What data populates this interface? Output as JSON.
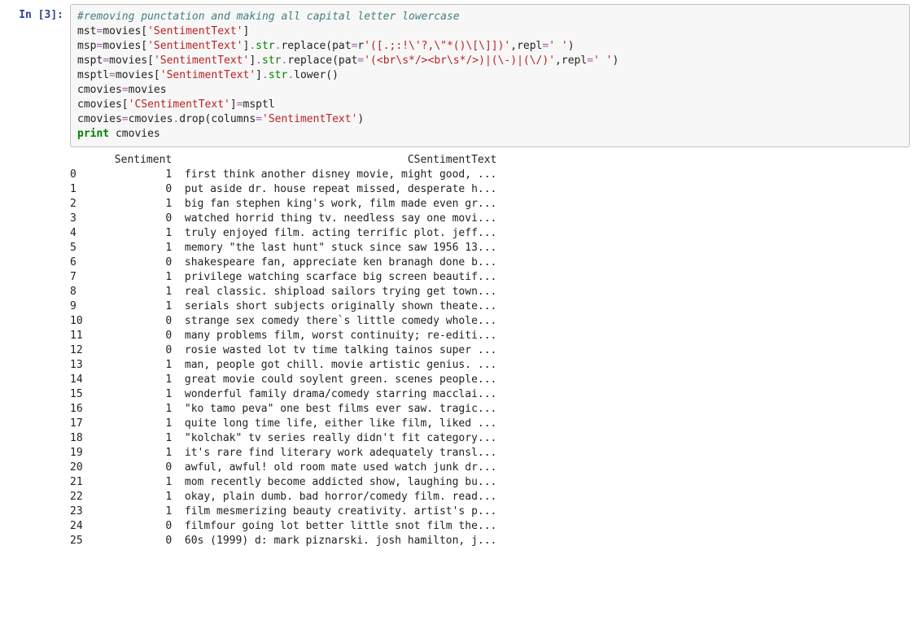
{
  "prompt": "In [3]:",
  "code": {
    "line1_comment": "#removing punctation and making all capital letter lowercase",
    "l2a": "mst",
    "l2b": "=",
    "l2c": "movies[",
    "l2d": "'SentimentText'",
    "l2e": "]",
    "l3a": "msp",
    "l3b": "=",
    "l3c": "movies[",
    "l3d": "'SentimentText'",
    "l3e": "]",
    "l3f": ".",
    "l3g": "str",
    "l3h": ".",
    "l3i": "replace(pat",
    "l3j": "=",
    "l3k": "r",
    "l3l": "'([.;:!\\'?,\\\"*()\\[\\]])'",
    "l3m": ",repl",
    "l3n": "=",
    "l3o": "' '",
    "l3p": ")",
    "l4a": "mspt",
    "l4b": "=",
    "l4c": "movies[",
    "l4d": "'SentimentText'",
    "l4e": "]",
    "l4f": ".",
    "l4g": "str",
    "l4h": ".",
    "l4i": "replace(pat",
    "l4j": "=",
    "l4l": "'(<br\\s*/><br\\s*/>)|(\\-)|(\\/)'",
    "l4m": ",repl",
    "l4n": "=",
    "l4o": "' '",
    "l4p": ")",
    "l5a": "msptl",
    "l5b": "=",
    "l5c": "movies[",
    "l5d": "'SentimentText'",
    "l5e": "]",
    "l5f": ".",
    "l5g": "str",
    "l5h": ".",
    "l5i": "lower()",
    "l6a": "cmovies",
    "l6b": "=",
    "l6c": "movies",
    "l7a": "cmovies[",
    "l7b": "'CSentimentText'",
    "l7c": "]",
    "l7d": "=",
    "l7e": "msptl",
    "l8a": "cmovies",
    "l8b": "=",
    "l8c": "cmovies",
    "l8d": ".",
    "l8e": "drop(columns",
    "l8f": "=",
    "l8g": "'SentimentText'",
    "l8h": ")",
    "l9a": "print",
    "l9b": " cmovies"
  },
  "output_header": "       Sentiment                                     CSentimentText",
  "rows": [
    {
      "i": "0",
      "s": "1",
      "t": "first think another disney movie, might good, ..."
    },
    {
      "i": "1",
      "s": "0",
      "t": "put aside dr. house repeat missed, desperate h..."
    },
    {
      "i": "2",
      "s": "1",
      "t": "big fan stephen king's work, film made even gr..."
    },
    {
      "i": "3",
      "s": "0",
      "t": "watched horrid thing tv. needless say one movi..."
    },
    {
      "i": "4",
      "s": "1",
      "t": "truly enjoyed film. acting terrific plot. jeff..."
    },
    {
      "i": "5",
      "s": "1",
      "t": "memory \"the last hunt\" stuck since saw 1956 13..."
    },
    {
      "i": "6",
      "s": "0",
      "t": "shakespeare fan, appreciate ken branagh done b..."
    },
    {
      "i": "7",
      "s": "1",
      "t": "privilege watching scarface big screen beautif..."
    },
    {
      "i": "8",
      "s": "1",
      "t": "real classic. shipload sailors trying get town..."
    },
    {
      "i": "9",
      "s": "1",
      "t": "serials short subjects originally shown theate..."
    },
    {
      "i": "10",
      "s": "0",
      "t": "strange sex comedy there`s little comedy whole..."
    },
    {
      "i": "11",
      "s": "0",
      "t": "many problems film, worst continuity; re-editi..."
    },
    {
      "i": "12",
      "s": "0",
      "t": "rosie wasted lot tv time talking tainos super ..."
    },
    {
      "i": "13",
      "s": "1",
      "t": "man, people got chill. movie artistic genius. ..."
    },
    {
      "i": "14",
      "s": "1",
      "t": "great movie could soylent green. scenes people..."
    },
    {
      "i": "15",
      "s": "1",
      "t": "wonderful family drama/comedy starring macclai..."
    },
    {
      "i": "16",
      "s": "1",
      "t": "\"ko tamo peva\" one best films ever saw. tragic..."
    },
    {
      "i": "17",
      "s": "1",
      "t": "quite long time life, either like film, liked ..."
    },
    {
      "i": "18",
      "s": "1",
      "t": "\"kolchak\" tv series really didn't fit category..."
    },
    {
      "i": "19",
      "s": "1",
      "t": "it's rare find literary work adequately transl..."
    },
    {
      "i": "20",
      "s": "0",
      "t": "awful, awful! old room mate used watch junk dr..."
    },
    {
      "i": "21",
      "s": "1",
      "t": "mom recently become addicted show, laughing bu..."
    },
    {
      "i": "22",
      "s": "1",
      "t": "okay, plain dumb. bad horror/comedy film. read..."
    },
    {
      "i": "23",
      "s": "1",
      "t": "film mesmerizing beauty creativity. artist's p..."
    },
    {
      "i": "24",
      "s": "0",
      "t": "filmfour going lot better little snot film the..."
    },
    {
      "i": "25",
      "s": "0",
      "t": "60s (1999) d: mark piznarski. josh hamilton, j..."
    }
  ]
}
